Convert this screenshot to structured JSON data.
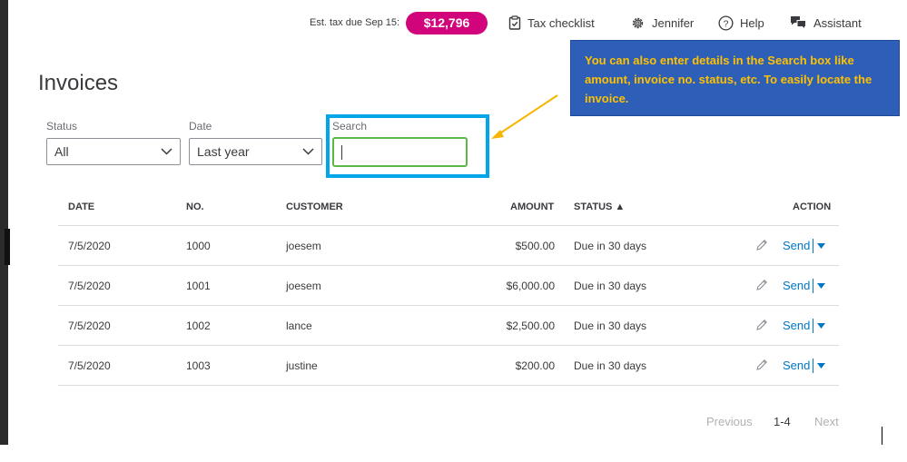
{
  "header": {
    "tax_label": "Est. tax due Sep 15:",
    "tax_amount": "$12,796",
    "tax_checklist": "Tax checklist",
    "user": "Jennifer",
    "help": "Help",
    "assistant": "Assistant"
  },
  "callout": {
    "text": "You can also enter details in the Search box like amount, invoice no. status, etc. To easily locate the invoice."
  },
  "page": {
    "title": "Invoices"
  },
  "filters": {
    "status_label": "Status",
    "status_value": "All",
    "date_label": "Date",
    "date_value": "Last year",
    "search_label": "Search",
    "search_value": ""
  },
  "table": {
    "columns": {
      "date": "DATE",
      "no": "NO.",
      "customer": "CUSTOMER",
      "amount": "AMOUNT",
      "status": "STATUS ▲",
      "action": "ACTION"
    },
    "rows": [
      {
        "date": "7/5/2020",
        "no": "1000",
        "customer": "joesem",
        "amount": "$500.00",
        "status": "Due in 30 days",
        "action": "Send"
      },
      {
        "date": "7/5/2020",
        "no": "1001",
        "customer": "joesem",
        "amount": "$6,000.00",
        "status": "Due in 30 days",
        "action": "Send"
      },
      {
        "date": "7/5/2020",
        "no": "1002",
        "customer": "lance",
        "amount": "$2,500.00",
        "status": "Due in 30 days",
        "action": "Send"
      },
      {
        "date": "7/5/2020",
        "no": "1003",
        "customer": "justine",
        "amount": "$200.00",
        "status": "Due in 30 days",
        "action": "Send"
      }
    ]
  },
  "pagination": {
    "previous": "Previous",
    "range": "1-4",
    "next": "Next"
  },
  "colors": {
    "accent_pink": "#d1047b",
    "link_blue": "#0077c5",
    "callout_bg": "#2e5fb8",
    "callout_text": "#ffc000",
    "highlight": "#00a6e8"
  }
}
